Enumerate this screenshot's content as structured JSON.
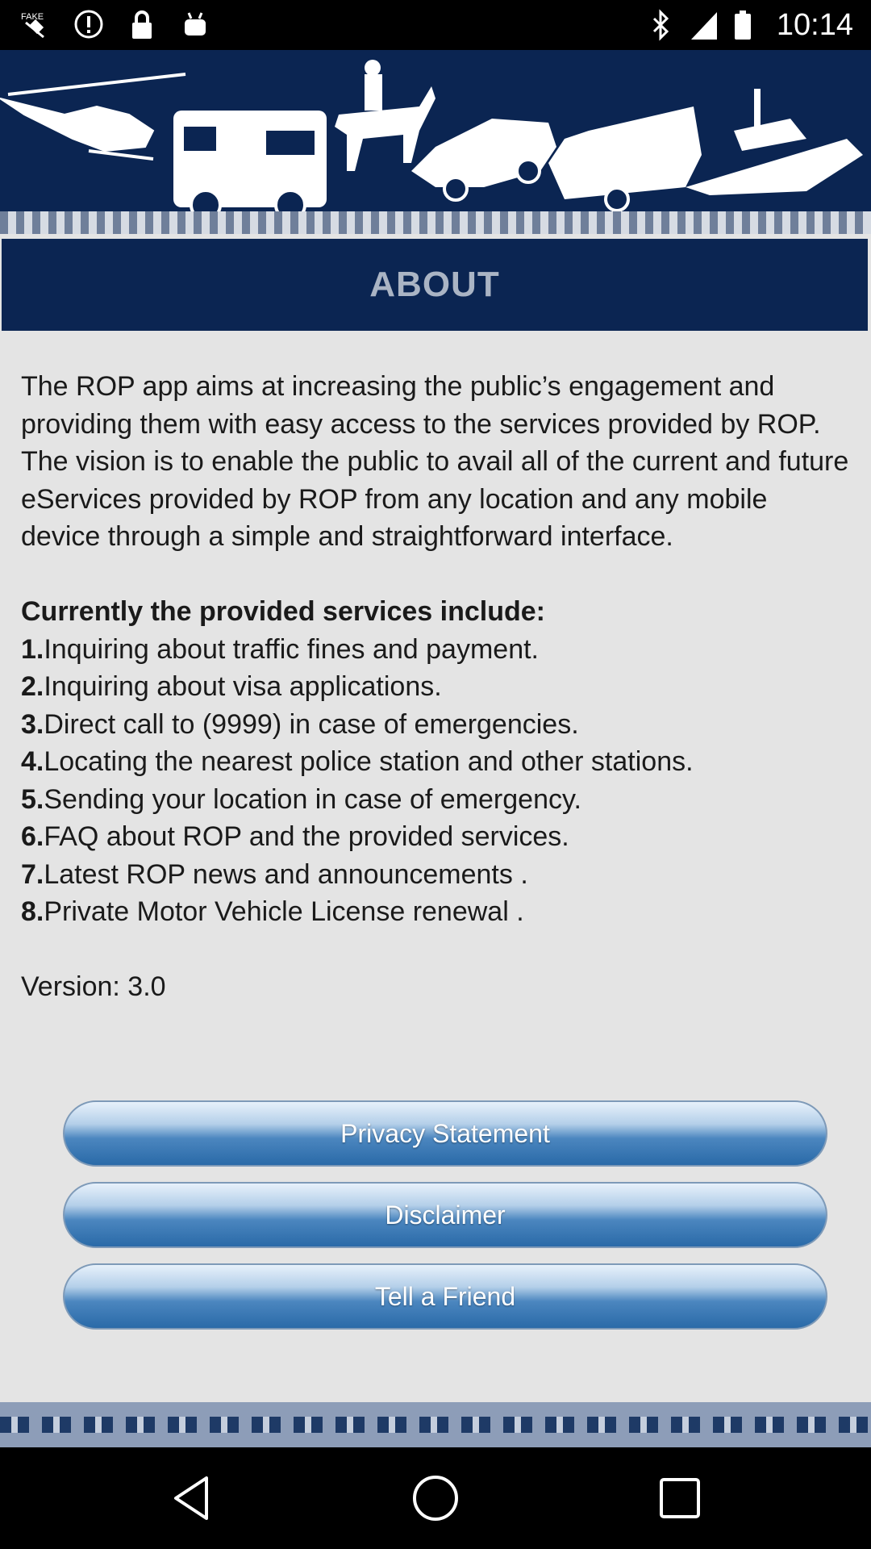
{
  "status_bar": {
    "time": "10:14",
    "left_icons": [
      "fake-gps-icon",
      "alert-circle-icon",
      "lock-icon",
      "android-icon"
    ],
    "right_icons": [
      "bluetooth-icon",
      "signal-icon",
      "battery-icon"
    ]
  },
  "banner": {
    "vehicles": [
      "helicopter",
      "fire-truck",
      "mounted-police",
      "police-car",
      "ambulance",
      "boat"
    ]
  },
  "header": {
    "title": "ABOUT"
  },
  "about": {
    "intro": "The ROP app aims at increasing the public’s engagement and providing them with easy access to the services provided by ROP. The vision is to enable the public to avail all of the current and future eServices provided by ROP from any location and any mobile device through a simple and straightforward interface.",
    "services_heading": "Currently the provided services include:",
    "services": [
      {
        "num": "1.",
        "text": "Inquiring about traffic fines and payment."
      },
      {
        "num": "2.",
        "text": "Inquiring about visa applications."
      },
      {
        "num": "3.",
        "text": "Direct call to (9999) in case of emergencies."
      },
      {
        "num": "4.",
        "text": "Locating the nearest police station and other stations."
      },
      {
        "num": "5.",
        "text": "Sending your location in case of emergency."
      },
      {
        "num": "6.",
        "text": "FAQ about ROP and the provided services."
      },
      {
        "num": "7.",
        "text": "Latest ROP news and announcements ."
      },
      {
        "num": "8.",
        "text": "Private Motor Vehicle License renewal ."
      }
    ],
    "version": "Version: 3.0"
  },
  "buttons": {
    "privacy": "Privacy Statement",
    "disclaimer": "Disclaimer",
    "tell_friend": "Tell a Friend"
  },
  "nav_bar": [
    "back-icon",
    "home-icon",
    "recents-icon"
  ],
  "colors": {
    "navy": "#0b2552",
    "button_blue": "#2a6aa8",
    "background": "#e4e4e4"
  }
}
